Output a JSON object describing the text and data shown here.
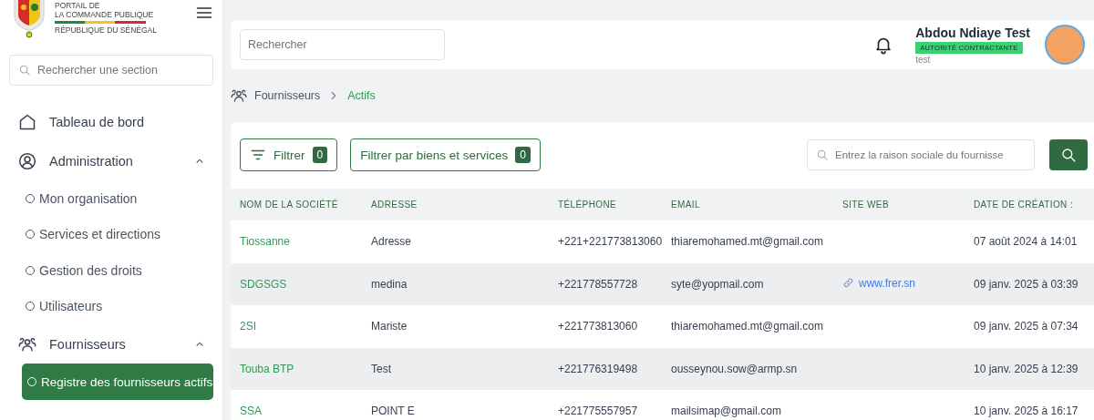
{
  "brand": {
    "line_1": "PORTAIL DE",
    "line_2": "LA COMMANDE PUBLIQUE",
    "line_3": "RÉPUBLIQUE DU SÉNÉGAL"
  },
  "sidebar": {
    "search": {
      "placeholder": "Rechercher une section"
    },
    "items": [
      {
        "label": "Tableau de bord"
      },
      {
        "label": "Administration",
        "expanded": true,
        "children": [
          {
            "label": "Mon organisation",
            "selected": false
          },
          {
            "label": "Services et directions",
            "selected": false
          },
          {
            "label": "Gestion des droits",
            "selected": false
          },
          {
            "label": "Utilisateurs",
            "selected": false
          }
        ]
      },
      {
        "label": "Fournisseurs",
        "expanded": true,
        "children": [
          {
            "label": "Registre des fournisseurs actifs",
            "selected": true
          }
        ]
      }
    ]
  },
  "header": {
    "search": {
      "placeholder": "Rechercher"
    },
    "user": {
      "name": "Abdou Ndiaye Test",
      "role": "AUTORITÉ CONTRACTANTE",
      "subtitle": "test"
    }
  },
  "breadcrumb": [
    {
      "label": "Fournisseurs",
      "current": false
    },
    {
      "label": "Actifs",
      "current": true
    }
  ],
  "filters": [
    {
      "label": "Filtrer",
      "count": "0",
      "kind": "with-icon"
    },
    {
      "label": "Filtrer par biens et services",
      "count": "0",
      "kind": "plain"
    }
  ],
  "supplier_search": {
    "placeholder": "Entrez la raison sociale du fournisse"
  },
  "table": {
    "columns": [
      "NOM DE LA SOCIÉTÉ",
      "ADRESSE",
      "TÉLÉPHONE",
      "EMAIL",
      "SITE WEB",
      "DATE DE CRÉATION :"
    ],
    "rows": [
      {
        "name": "Tiossanne",
        "address": "Adresse",
        "phone": "+221+221773813060",
        "email": "thiaremohamed.mt@gmail.com",
        "created": "07 août 2024 à 14:01"
      },
      {
        "name": "SDGSGS",
        "address": "medina",
        "phone": "+221778557728",
        "email": "syte@yopmail.com",
        "website": "www.frer.sn",
        "created": "09 janv. 2025 à 03:39"
      },
      {
        "name": "2SI",
        "address": "Mariste",
        "phone": "+221773813060",
        "email": "thiaremohamed.mt@gmail.com",
        "created": "09 janv. 2025 à 07:34"
      },
      {
        "name": "Touba BTP",
        "address": "Test",
        "phone": "+221776319498",
        "email": "ousseynou.sow@armp.sn",
        "created": "10 janv. 2025 à 12:39"
      },
      {
        "name": "SSA",
        "address": "POINT E",
        "phone": "+221775557957",
        "email": "mailsimap@gmail.com",
        "created": "10 janv. 2025 à 16:17"
      }
    ]
  }
}
